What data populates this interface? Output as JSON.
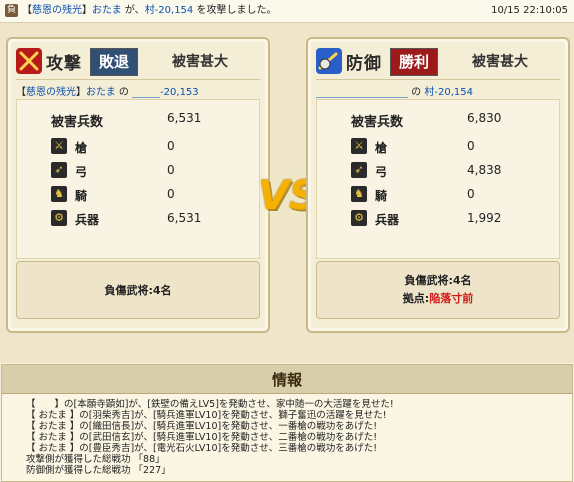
{
  "top": {
    "badge": "負",
    "prefix": "【",
    "alliance": "慈恩の残光",
    "suffix": "】",
    "player": "おたま",
    "connector": " が、",
    "village": "村-20,154",
    "tail": " を攻撃しました。",
    "timestamp": "10/15 22:10:05"
  },
  "attack": {
    "label": "攻撃",
    "result": "敗退",
    "damage": "被害甚大",
    "player_prefix": "【",
    "player_alliance": "慈恩の残光",
    "player_close": "】",
    "player_name": "おたま",
    "player_sep": " の ",
    "player_village": "-20,153",
    "casualties_label": "被害兵数",
    "casualties": "6,531",
    "spear_label": "槍",
    "spear": "0",
    "bow_label": "弓",
    "bow": "0",
    "cavalry_label": "騎",
    "cavalry": "0",
    "weapon_label": "兵器",
    "weapon": "6,531",
    "injured": "負傷武将:4名"
  },
  "defense": {
    "label": "防御",
    "result": "勝利",
    "damage": "被害甚大",
    "player_sep": " の ",
    "player_village": "村-20,154",
    "casualties_label": "被害兵数",
    "casualties": "6,830",
    "spear_label": "槍",
    "spear": "0",
    "bow_label": "弓",
    "bow": "4,838",
    "cavalry_label": "騎",
    "cavalry": "0",
    "weapon_label": "兵器",
    "weapon": "1,992",
    "injured": "負傷武将:4名",
    "base_label": "拠点:",
    "base_status": "陥落寸前"
  },
  "vs": "VS",
  "info": {
    "title": "情報",
    "lines": [
      "【　　】の[本願寺顕如]が、[鉄壁の備えLV5]を発動させ、家中随一の大活躍を見せた!",
      "【 おたま 】の[羽柴秀吉]が、[騎兵進軍LV10]を発動させ、獅子奮迅の活躍を見せた!",
      "【 おたま 】の[織田信長]が、[騎兵進軍LV10]を発動させ、一番槍の戦功をあげた!",
      "【 おたま 】の[武田信玄]が、[騎兵進軍LV10]を発動させ、二番槍の戦功をあげた!",
      "【 おたま 】の[豊臣秀吉]が、[電光石火LV10]を発動させ、三番槍の戦功をあげた!",
      "攻撃側が獲得した総戦功 「88」",
      "防御側が獲得した総戦功 「227」"
    ]
  },
  "colors": {
    "attack": "#b81a1a",
    "defense": "#2a5fc9",
    "lose_badge": "#2f4f74",
    "win_badge": "#9b1a1a",
    "vs": "#f5b000",
    "link": "#0a4fb0"
  }
}
